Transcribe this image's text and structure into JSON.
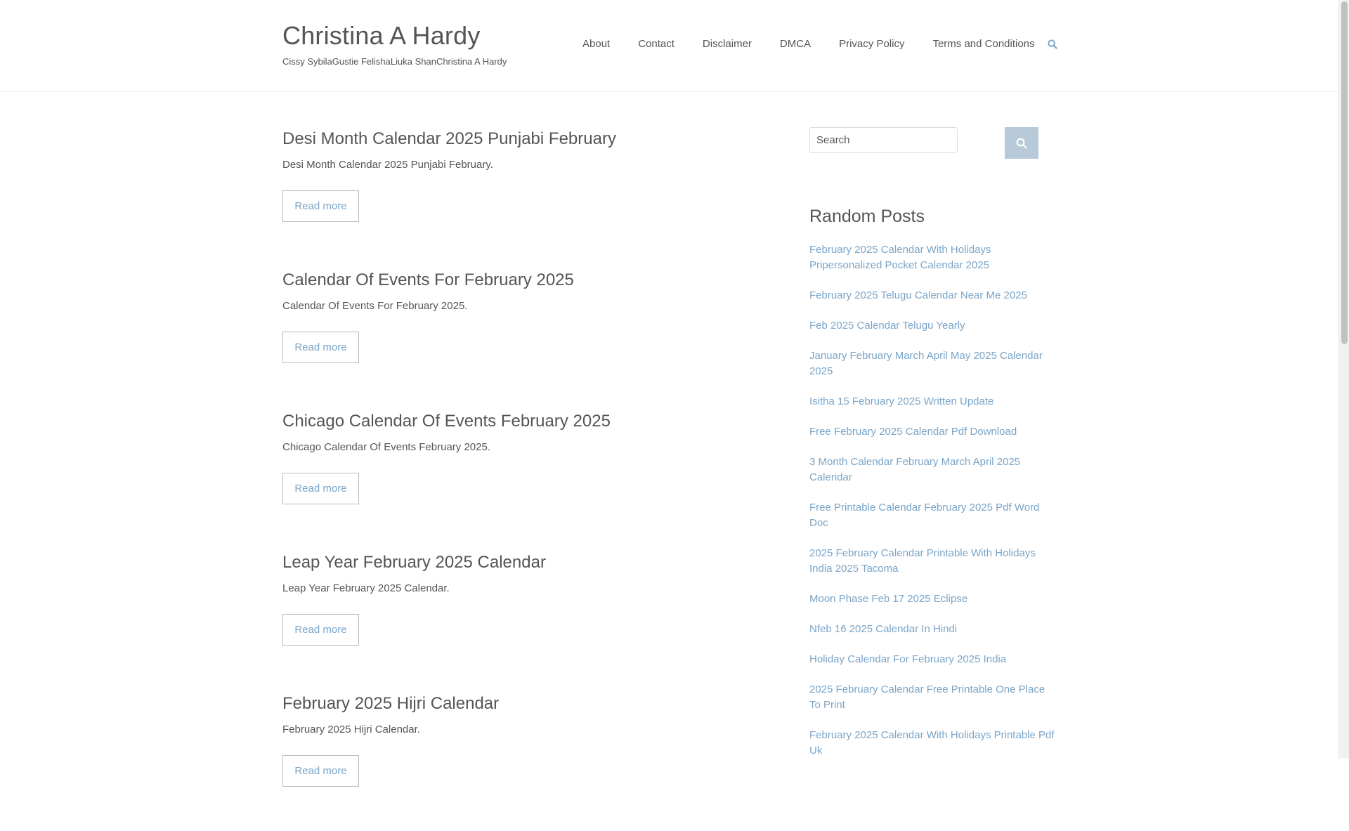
{
  "site": {
    "title": "Christina A Hardy",
    "tagline": "Cissy SybilaGustie FelishaLiuka ShanChristina A Hardy"
  },
  "nav": {
    "items": [
      {
        "label": "About"
      },
      {
        "label": "Contact"
      },
      {
        "label": "Disclaimer"
      },
      {
        "label": "DMCA"
      },
      {
        "label": "Privacy Policy"
      },
      {
        "label": "Terms and Conditions"
      }
    ],
    "search_icon": "search-icon"
  },
  "posts": [
    {
      "title": "Desi Month Calendar 2025 Punjabi February",
      "excerpt": "Desi Month Calendar 2025 Punjabi February.",
      "read_more": "Read more"
    },
    {
      "title": "Calendar Of Events For February 2025",
      "excerpt": "Calendar Of Events For February 2025.",
      "read_more": "Read more"
    },
    {
      "title": "Chicago Calendar Of Events February 2025",
      "excerpt": "Chicago Calendar Of Events February 2025.",
      "read_more": "Read more"
    },
    {
      "title": "Leap Year February 2025 Calendar",
      "excerpt": "Leap Year February 2025 Calendar.",
      "read_more": "Read more"
    },
    {
      "title": "February 2025 Hijri Calendar",
      "excerpt": "February 2025 Hijri Calendar.",
      "read_more": "Read more"
    }
  ],
  "sidebar": {
    "search": {
      "placeholder": "Search"
    },
    "random_posts_title": "Random Posts",
    "random_posts": [
      "February 2025 Calendar With Holidays Pripersonalized Pocket Calendar 2025",
      "February 2025 Telugu Calendar Near Me 2025",
      "Feb 2025 Calendar Telugu Yearly",
      "January February March April May 2025 Calendar 2025",
      "Isitha 15 February 2025 Written Update",
      "Free February 2025 Calendar Pdf Download",
      "3 Month Calendar February March April 2025 Calendar",
      "Free Printable Calendar February 2025 Pdf Word Doc",
      "2025 February Calendar Printable With Holidays India 2025 Tacoma",
      "Moon Phase Feb 17 2025 Eclipse",
      "Nfeb 16 2025 Calendar In Hindi",
      "Holiday Calendar For February 2025 India",
      "2025 February Calendar Free Printable One Place To Print",
      "February 2025 Calendar With Holidays Printable Pdf Uk"
    ]
  },
  "colors": {
    "text": "#555555",
    "link": "#7aa5c8",
    "search_button": "#b8c9d9",
    "border": "#eeeeee"
  }
}
